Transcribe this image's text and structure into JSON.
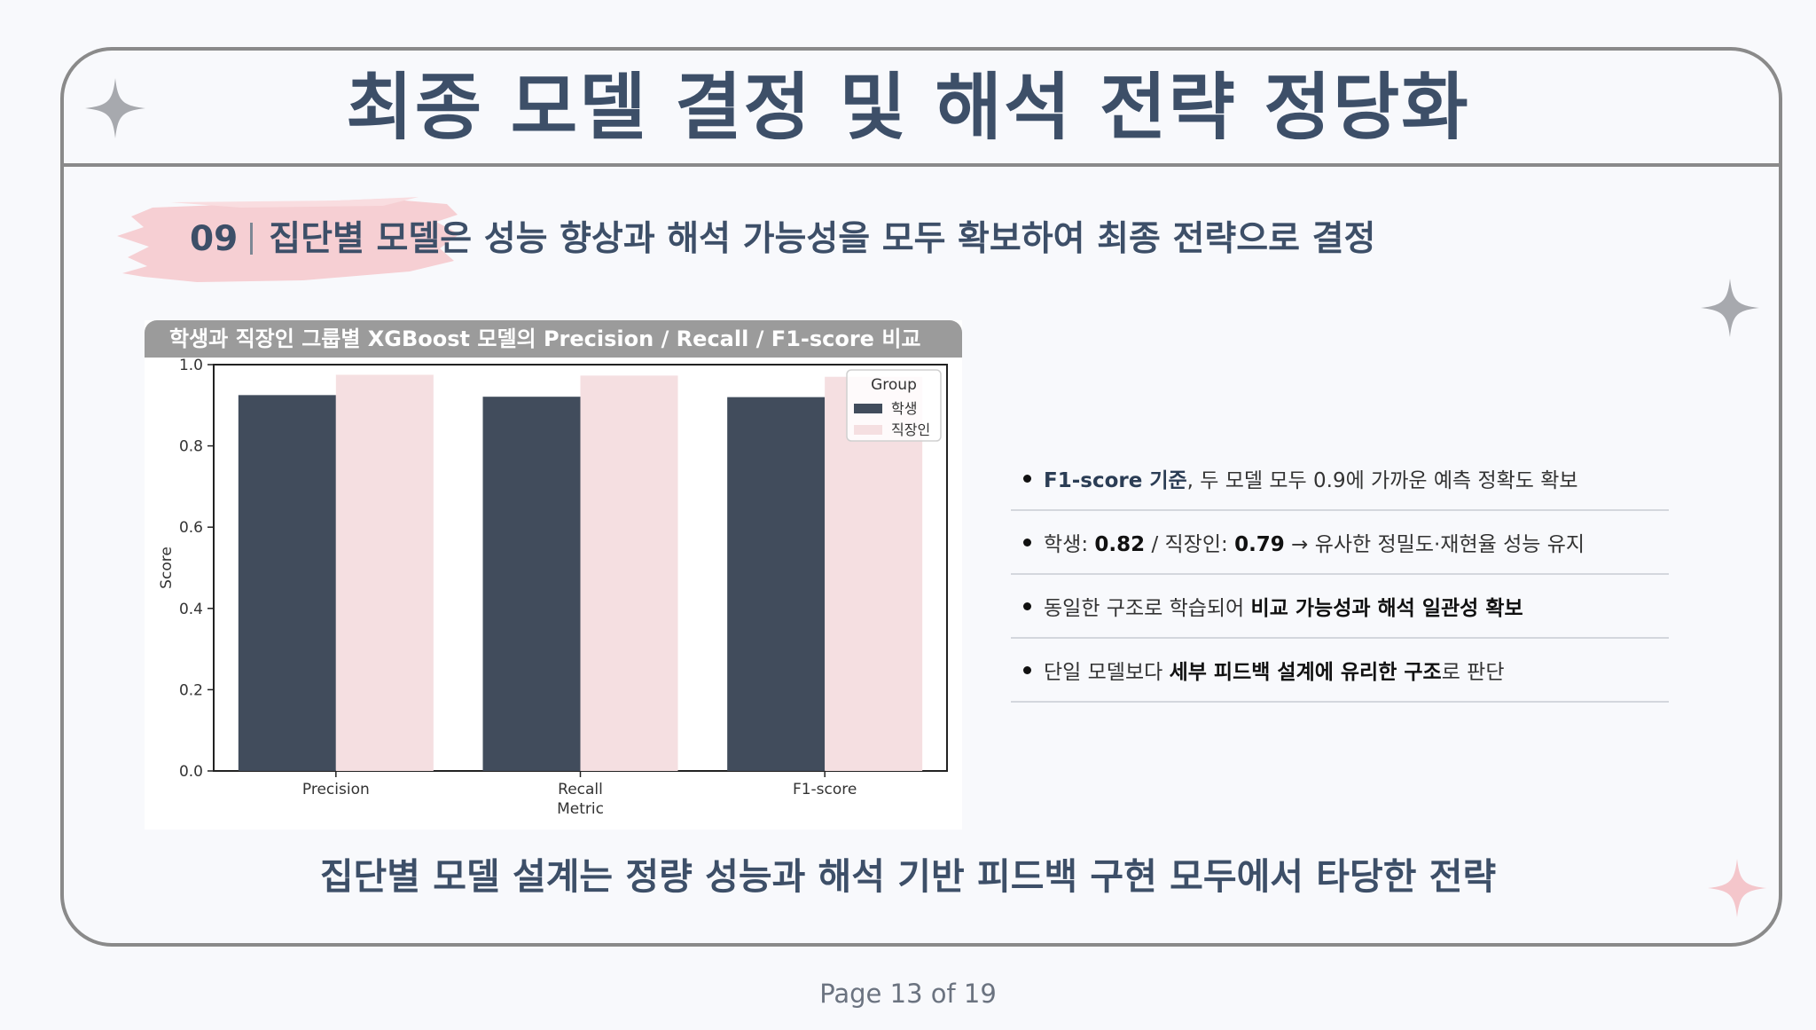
{
  "slide": {
    "title": "최종 모델 결정 및 해석 전략 정당화",
    "section_number": "09",
    "subtitle": "집단별 모델은 성능 향상과 해석 가능성을 모두 확보하여 최종 전략으로 결정",
    "conclusion": "집단별 모델 설계는 정량 성능과 해석 기반 피드백 구현 모두에서 타당한 전략",
    "page_label": "Page 13 of 19"
  },
  "chart_panel": {
    "header": "학생과 직장인 그룹별 XGBoost 모델의 Precision / Recall / F1-score 비교"
  },
  "chart_data": {
    "type": "bar",
    "title": "",
    "xlabel": "Metric",
    "ylabel": "Score",
    "categories": [
      "Precision",
      "Recall",
      "F1-score"
    ],
    "ylim": [
      0,
      1.0
    ],
    "yticks": [
      "0.0",
      "0.2",
      "0.4",
      "0.6",
      "0.8",
      "1.0"
    ],
    "grid": false,
    "legend_title": "Group",
    "legend_position": "top-right",
    "series": [
      {
        "name": "학생",
        "color": "#414c5c",
        "values": [
          0.925,
          0.921,
          0.92
        ]
      },
      {
        "name": "직장인",
        "color": "#f5dfe1",
        "values": [
          0.975,
          0.973,
          0.97
        ]
      }
    ]
  },
  "bullets": [
    {
      "parts": [
        {
          "t": "F1-score 기준",
          "s": "accent"
        },
        {
          "t": ", 두 모델 모두 0.9에 가까운 예측 정확도 확보",
          "s": ""
        }
      ]
    },
    {
      "parts": [
        {
          "t": "학생: ",
          "s": ""
        },
        {
          "t": "0.82",
          "s": "bold"
        },
        {
          "t": " / 직장인: ",
          "s": ""
        },
        {
          "t": "0.79",
          "s": "bold"
        },
        {
          "t": " → 유사한 정밀도·재현율 성능 유지",
          "s": ""
        }
      ]
    },
    {
      "parts": [
        {
          "t": "동일한 구조로 학습되어 ",
          "s": ""
        },
        {
          "t": "비교 가능성과 해석 일관성 확보",
          "s": "bold"
        }
      ]
    },
    {
      "parts": [
        {
          "t": "단일 모델보다 ",
          "s": ""
        },
        {
          "t": "세부 피드백 설계에 유리한 구조",
          "s": "bold"
        },
        {
          "t": "로 판단",
          "s": ""
        }
      ]
    }
  ],
  "colors": {
    "title": "#3d4f68",
    "frame": "#8a8a8a",
    "brush": "#f6cfd3",
    "sparkle_gray": "#a7a9ae",
    "sparkle_pink": "#f4c6cb"
  },
  "icons": [
    "sparkle-icon",
    "sparkle-icon",
    "sparkle-pink-icon"
  ]
}
